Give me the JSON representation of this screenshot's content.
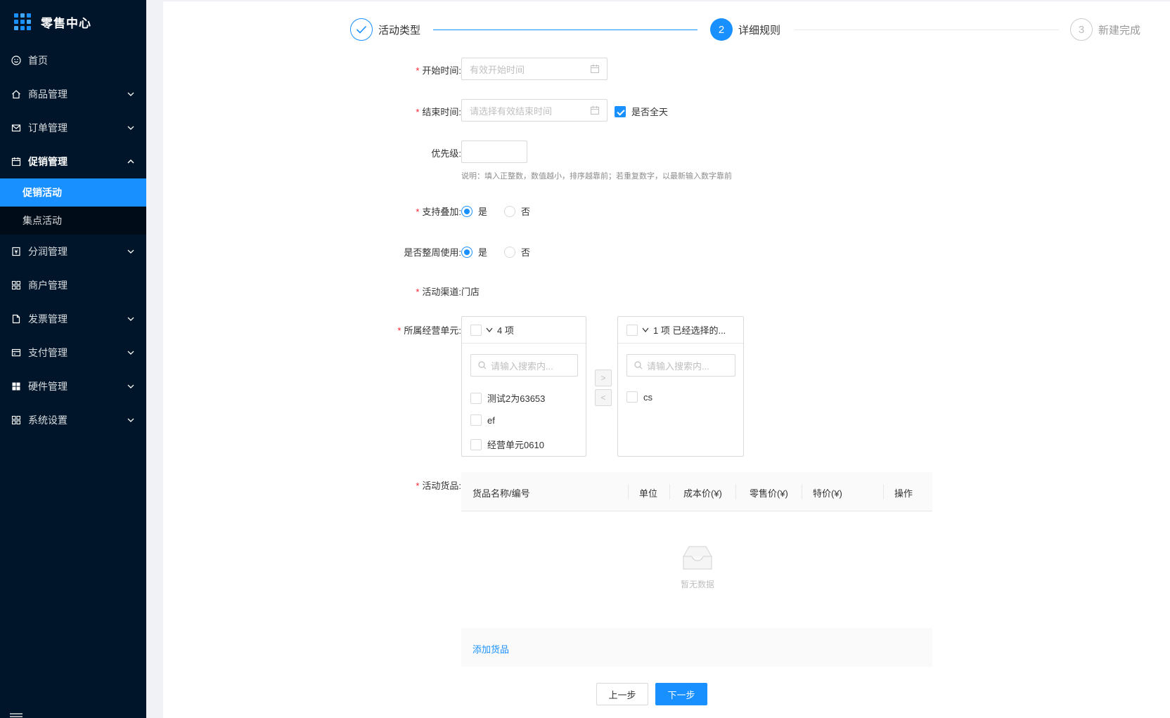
{
  "sidebar": {
    "title": "零售中心",
    "items": [
      {
        "label": "首页"
      },
      {
        "label": "商品管理"
      },
      {
        "label": "订单管理"
      },
      {
        "label": "促销管理"
      },
      {
        "label": "分润管理"
      },
      {
        "label": "商户管理"
      },
      {
        "label": "发票管理"
      },
      {
        "label": "支付管理"
      },
      {
        "label": "硬件管理"
      },
      {
        "label": "系统设置"
      }
    ],
    "sub_items": [
      {
        "label": "促销活动"
      },
      {
        "label": "集点活动"
      }
    ]
  },
  "steps": [
    {
      "title": "活动类型",
      "status": "done"
    },
    {
      "title": "详细规则",
      "number": "2",
      "status": "process"
    },
    {
      "title": "新建完成",
      "number": "3",
      "status": "wait"
    }
  ],
  "form": {
    "start_time": {
      "label": "开始时间:",
      "placeholder": "有效开始时间"
    },
    "end_time": {
      "label": "结束时间:",
      "placeholder": "请选择有效结束时间",
      "all_day_label": "是否全天",
      "all_day_checked": true
    },
    "priority": {
      "label": "优先级:",
      "value": "",
      "hint": "说明：填入正整数，数值越小，排序越靠前；若重复数字，以最新输入数字靠前"
    },
    "stackable": {
      "label": "支持叠加:",
      "yes": "是",
      "no": "否",
      "selected": "是"
    },
    "whole_week": {
      "label": "是否整周使用:",
      "yes": "是",
      "no": "否",
      "selected": "是"
    },
    "channel": {
      "label": "活动渠道:",
      "value": "门店"
    },
    "units": {
      "label": "所属经营单元:",
      "left": {
        "header": "4 项",
        "search_placeholder": "请输入搜索内...",
        "items": [
          "测试2为63653",
          "ef",
          "经营单元0610"
        ]
      },
      "right": {
        "header": "1 项 已经选择的...",
        "search_placeholder": "请输入搜索内...",
        "items": [
          "cs"
        ]
      },
      "to_right": ">",
      "to_left": "<"
    },
    "goods": {
      "label": "活动货品:",
      "columns": [
        "货品名称/编号",
        "单位",
        "成本价(¥)",
        "零售价(¥)",
        "特价(¥)",
        "操作"
      ],
      "empty_text": "暂无数据",
      "add_label": "添加货品"
    }
  },
  "buttons": {
    "prev": "上一步",
    "next": "下一步"
  },
  "colors": {
    "primary": "#1890ff",
    "sidebar_bg": "#001529",
    "required": "#f5222d"
  }
}
